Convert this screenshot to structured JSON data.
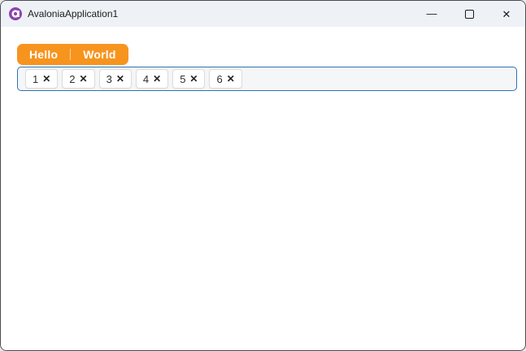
{
  "window": {
    "title": "AvaloniaApplication1",
    "titlebar": {
      "app_icon": "avalonia-logo",
      "buttons": {
        "minimize": {
          "name": "minimize",
          "glyph": "—"
        },
        "maximize": {
          "name": "maximize",
          "glyph": "□"
        },
        "close": {
          "name": "close",
          "glyph": "✕"
        }
      }
    }
  },
  "tabs": {
    "items": [
      {
        "label": "Hello",
        "selected": true
      },
      {
        "label": "World",
        "selected": false
      }
    ]
  },
  "chips": {
    "close_glyph": "✕",
    "items": [
      {
        "label": "1"
      },
      {
        "label": "2"
      },
      {
        "label": "3"
      },
      {
        "label": "4"
      },
      {
        "label": "5"
      },
      {
        "label": "6"
      }
    ]
  },
  "colors": {
    "accent_orange": "#F7941E",
    "focus_border_blue": "#2D72B0",
    "titlebar_bg": "#EEF2F7",
    "field_bg": "#F5F6F8",
    "chip_border": "#DCDCDC",
    "window_border": "#4A4D50",
    "logo_purple": "#8B44AC"
  }
}
